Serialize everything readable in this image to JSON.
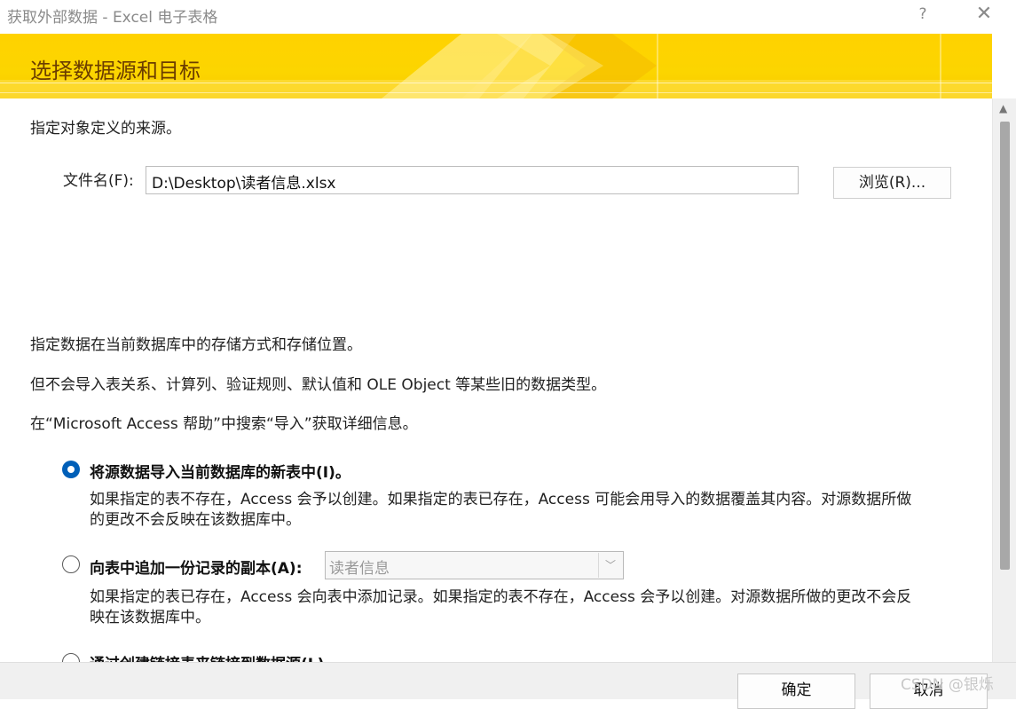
{
  "window": {
    "title": "获取外部数据 - Excel 电子表格",
    "help_glyph": "?",
    "close_glyph": "✕"
  },
  "banner": {
    "title": "选择数据源和目标",
    "accent_color": "#ffd200"
  },
  "source": {
    "intro": "指定对象定义的来源。",
    "file_label": "文件名(F):",
    "file_value": "D:\\Desktop\\读者信息.xlsx",
    "browse_label": "浏览(R)..."
  },
  "storage": {
    "line1": "指定数据在当前数据库中的存储方式和存储位置。",
    "line2": "但不会导入表关系、计算列、验证规则、默认值和 OLE Object 等某些旧的数据类型。",
    "line3": "在“Microsoft Access 帮助”中搜索“导入”获取详细信息。"
  },
  "options": [
    {
      "label": "将源数据导入当前数据库的新表中(I)。",
      "selected": true,
      "desc_line1": "如果指定的表不存在，Access 会予以创建。如果指定的表已存在，Access 可能会用导入的数据覆盖其内容。对源数据所做",
      "desc_line2": "的更改不会反映在该数据库中。"
    },
    {
      "label": "向表中追加一份记录的副本(A):",
      "selected": false,
      "combo_value": "读者信息",
      "desc_line1": "如果指定的表已存在，Access 会向表中添加记录。如果指定的表不存在，Access 会予以创建。对源数据所做的更改不会反",
      "desc_line2": "映在该数据库中。"
    },
    {
      "label": "通过创建链接表来链接到数据源(L)。",
      "selected": false
    }
  ],
  "footer": {
    "ok_label": "确定",
    "cancel_label": "取消",
    "watermark": "CSDN @银烁"
  },
  "colors": {
    "radio_selected": "#005fb8",
    "banner_text": "#6b3d00"
  }
}
